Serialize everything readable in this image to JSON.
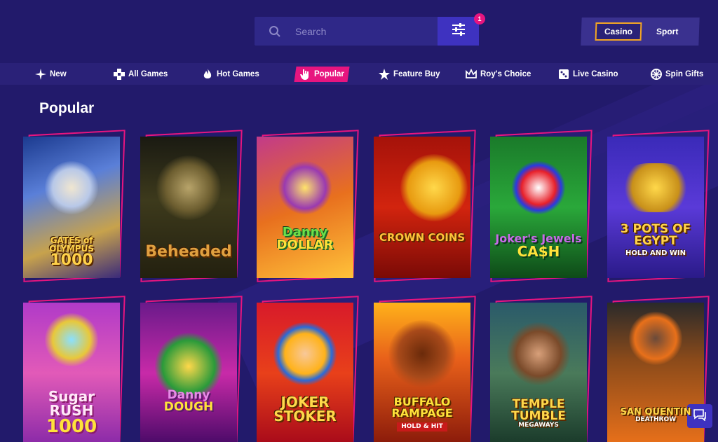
{
  "search": {
    "placeholder": "Search"
  },
  "filter": {
    "badge_count": "1"
  },
  "mode": {
    "casino_label": "Casino",
    "sport_label": "Sport",
    "active": "Casino"
  },
  "nav": [
    {
      "label": "New",
      "icon": "sparkle-icon"
    },
    {
      "label": "All Games",
      "icon": "grid-icon"
    },
    {
      "label": "Hot Games",
      "icon": "flame-icon"
    },
    {
      "label": "Popular",
      "icon": "hand-icon",
      "active": true
    },
    {
      "label": "Feature Buy",
      "icon": "star-icon"
    },
    {
      "label": "Roy's Choice",
      "icon": "crown-icon"
    },
    {
      "label": "Live Casino",
      "icon": "dice-icon"
    },
    {
      "label": "Spin Gifts",
      "icon": "wheel-icon"
    }
  ],
  "section": {
    "title": "Popular"
  },
  "games": [
    {
      "title": "GATES of OLYMPUS 1000",
      "line1": "GATES of OLYMPUS",
      "line2": "1000"
    },
    {
      "title": "Beheaded",
      "line1": "Beheaded",
      "line2": ""
    },
    {
      "title": "Danny DOLLAR",
      "line1": "Danny",
      "line2": "DOLLAR"
    },
    {
      "title": "CROWN COINS",
      "line1": "CROWN COINS",
      "line2": ""
    },
    {
      "title": "Joker's Jewels CA$H",
      "line1": "Joker's Jewels",
      "line2": "CA$H"
    },
    {
      "title": "3 POTS OF EGYPT HOLD AND WIN",
      "line1": "3 POTS OF EGYPT",
      "line2": "HOLD AND WIN"
    },
    {
      "title": "Sugar RUSH 1000",
      "line1": "Sugar RUSH",
      "line2": "1000"
    },
    {
      "title": "Danny DOUGH",
      "line1": "Danny",
      "line2": "DOUGH"
    },
    {
      "title": "JOKER STOKER",
      "line1": "JOKER",
      "line2": "STOKER"
    },
    {
      "title": "BUFFALO RAMPAGE HOLD & HIT",
      "line1": "BUFFALO RAMPAGE",
      "line2": "HOLD & HIT"
    },
    {
      "title": "TEMPLE TUMBLE MEGAWAYS",
      "line1": "TEMPLE TUMBLE",
      "line2": "MEGAWAYS"
    },
    {
      "title": "SAN QUENTIN DEATHROW",
      "line1": "SAN QUENTIN",
      "line2": "DEATHROW"
    }
  ],
  "colors": {
    "background": "#221a6b",
    "nav_bar": "#2a2178",
    "accent_pink": "#e7157f",
    "accent_blue": "#3e32c0",
    "active_outline": "#f4a623"
  }
}
